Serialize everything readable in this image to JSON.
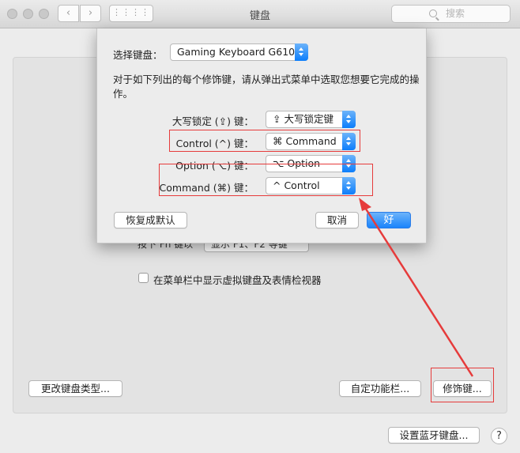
{
  "window": {
    "title": "键盘",
    "nav_back": "‹",
    "nav_forward": "›",
    "grid_glyph": "⋮⋮⋮⋮",
    "search_placeholder": "搜索"
  },
  "pane": {
    "partial_label": "按下 Fn 键以",
    "partial_select": "显示 F1、F2 等键",
    "checkbox_label": "在菜单栏中显示虚拟键盘及表情检视器",
    "change_type_button": "更改键盘类型...",
    "customize_strip_button": "自定功能栏...",
    "modifier_keys_button": "修饰键...",
    "bluetooth_button": "设置蓝牙键盘...",
    "help_button": "?"
  },
  "sheet": {
    "select_keyboard_label": "选择键盘：",
    "selected_keyboard": "Gaming Keyboard G610",
    "description": "对于如下列出的每个修饰键，请从弹出式菜单中选取您想要它完成的操作。",
    "rows": [
      {
        "label": "大写锁定 (⇪) 键：",
        "value": "⇪ 大写锁定键"
      },
      {
        "label": "Control (^) 键：",
        "value": "⌘ Command"
      },
      {
        "label": "Option (⌥) 键：",
        "value": "⌥ Option"
      },
      {
        "label": "Command (⌘) 键：",
        "value": "^ Control"
      }
    ],
    "restore_defaults_button": "恢复成默认",
    "cancel_button": "取消",
    "ok_button": "好"
  },
  "colors": {
    "accent": "#1b84fb",
    "annotation_red": "#e63b3b"
  }
}
